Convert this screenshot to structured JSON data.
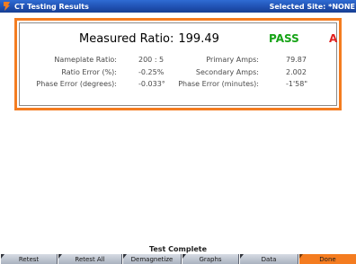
{
  "window": {
    "title": "CT Testing Results",
    "site": "Selected Site: *NONE"
  },
  "result": {
    "measured_label": "Measured Ratio:",
    "measured_value": "199.49",
    "pass_text": "PASS",
    "grade": "A",
    "nameplate_label": "Nameplate Ratio:",
    "nameplate_value": "200 : 5",
    "ratio_error_label": "Ratio Error (%):",
    "ratio_error_value": "-0.25%",
    "phase_error_deg_label": "Phase Error (degrees):",
    "phase_error_deg_value": "-0.033°",
    "primary_amps_label": "Primary Amps:",
    "primary_amps_value": "79.87",
    "secondary_amps_label": "Secondary Amps:",
    "secondary_amps_value": "2.002",
    "phase_error_min_label": "Phase Error (minutes):",
    "phase_error_min_value": "-1'58\""
  },
  "status": "Test Complete",
  "softkeys": [
    "Retest",
    "Retest All",
    "Demagnetize",
    "Graphs",
    "Data",
    "Done"
  ],
  "colors": {
    "titlebar": "#1f4fb0",
    "panel_border": "#f47c20",
    "pass": "#16a316",
    "grade": "#e0201e",
    "done_key": "#f47c20"
  }
}
